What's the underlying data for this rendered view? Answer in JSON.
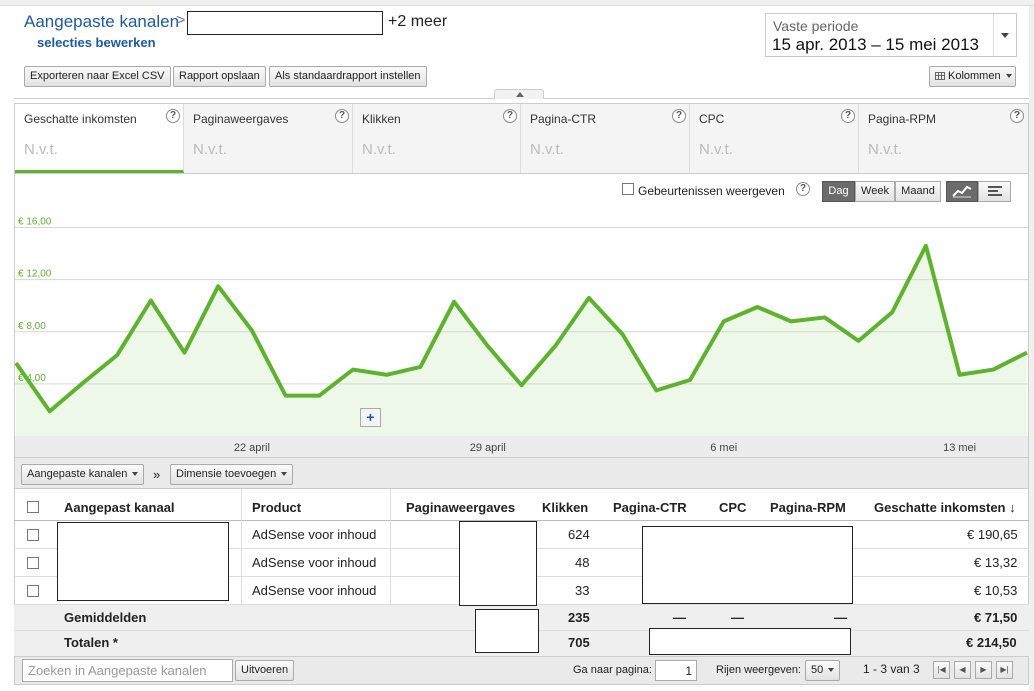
{
  "header": {
    "title": "Aangepaste kanalen",
    "title_separator": ">",
    "more_label": "+2 meer",
    "edit_link": "selecties bewerken"
  },
  "period": {
    "label": "Vaste periode",
    "value": "15 apr. 2013 – 15 mei 2013"
  },
  "toolbar": {
    "export_label": "Exporteren naar Excel CSV",
    "save_label": "Rapport opslaan",
    "default_label": "Als standaardrapport instellen",
    "columns_label": "Kolommen"
  },
  "metrics": [
    {
      "label": "Geschatte inkomsten",
      "value": "N.v.t.",
      "selected": true
    },
    {
      "label": "Paginaweergaves",
      "value": "N.v.t."
    },
    {
      "label": "Klikken",
      "value": "N.v.t."
    },
    {
      "label": "Pagina-CTR",
      "value": "N.v.t."
    },
    {
      "label": "CPC",
      "value": "N.v.t."
    },
    {
      "label": "Pagina-RPM",
      "value": "N.v.t."
    }
  ],
  "help_glyph": "?",
  "chart_controls": {
    "events_label": "Gebeurtenissen weergeven",
    "day": "Dag",
    "week": "Week",
    "month": "Maand"
  },
  "chart_data": {
    "type": "area",
    "ylim": [
      0,
      17.5
    ],
    "y_ticks": [
      {
        "value": 4,
        "label": "€ 4,00"
      },
      {
        "value": 8,
        "label": "€ 8,00"
      },
      {
        "value": 12,
        "label": "€ 12,00"
      },
      {
        "value": 16,
        "label": "€ 16,00"
      }
    ],
    "x_tick_labels": [
      {
        "index": 7,
        "label": "22 april"
      },
      {
        "index": 14,
        "label": "29 april"
      },
      {
        "index": 21,
        "label": "6 mei"
      },
      {
        "index": 28,
        "label": "13 mei"
      }
    ],
    "x": [
      "15 apr",
      "16 apr",
      "17 apr",
      "18 apr",
      "19 apr",
      "20 apr",
      "21 apr",
      "22 apr",
      "23 apr",
      "24 apr",
      "25 apr",
      "26 apr",
      "27 apr",
      "28 apr",
      "29 apr",
      "30 apr",
      "1 mei",
      "2 mei",
      "3 mei",
      "4 mei",
      "5 mei",
      "6 mei",
      "7 mei",
      "8 mei",
      "9 mei",
      "10 mei",
      "11 mei",
      "12 mei",
      "13 mei",
      "14 mei",
      "15 mei"
    ],
    "values": [
      5.6,
      1.9,
      4.1,
      6.2,
      10.4,
      6.4,
      11.5,
      8.1,
      3.1,
      3.1,
      5.1,
      4.7,
      5.3,
      10.3,
      6.9,
      3.9,
      6.9,
      10.6,
      7.8,
      3.5,
      4.3,
      8.8,
      9.9,
      8.8,
      9.1,
      7.3,
      9.5,
      14.6,
      4.7,
      5.1,
      6.4
    ],
    "line_color": "#5db32d",
    "fill_color": "#eef8e8",
    "grid": true
  },
  "dimension_bar": {
    "channel_select": "Aangepaste kanalen",
    "separator": "»",
    "add_dimension": "Dimensie toevoegen"
  },
  "table": {
    "headers": {
      "channel": "Aangepast kanaal",
      "product": "Product",
      "pageviews": "Paginaweergaves",
      "clicks": "Klikken",
      "ctr": "Pagina-CTR",
      "cpc": "CPC",
      "rpm": "Pagina-RPM",
      "earnings": "Geschatte inkomsten ↓"
    },
    "rows": [
      {
        "product": "AdSense voor inhoud",
        "clicks": "624",
        "earnings": "€ 190,65"
      },
      {
        "product": "AdSense voor inhoud",
        "clicks": "48",
        "earnings": "€ 13,32"
      },
      {
        "product": "AdSense voor inhoud",
        "clicks": "33",
        "earnings": "€ 10,53"
      }
    ],
    "averages": {
      "label": "Gemiddelden",
      "clicks": "235",
      "ctr": "—",
      "cpc": "—",
      "rpm": "—",
      "earnings": "€ 71,50"
    },
    "totals": {
      "label": "Totalen *",
      "clicks": "705",
      "earnings": "€ 214,50"
    }
  },
  "footer": {
    "search_placeholder": "Zoeken in Aangepaste kanalen",
    "run_label": "Uitvoeren",
    "goto_label": "Ga naar pagina:",
    "page_value": "1",
    "rows_label": "Rijen weergeven:",
    "rows_value": "50",
    "range_label": "1 - 3 van 3"
  }
}
